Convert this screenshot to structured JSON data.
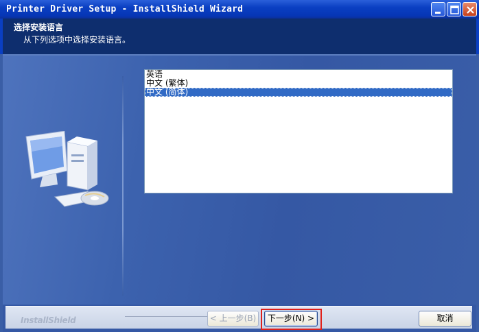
{
  "window": {
    "title": "Printer Driver Setup - InstallShield Wizard",
    "controls": [
      "minimize-icon",
      "maximize-icon",
      "close-icon"
    ]
  },
  "header": {
    "title": "选择安装语言",
    "subtitle": "从下列选项中选择安装语言。"
  },
  "languages": {
    "items": [
      "英语",
      "中文 (繁体)",
      "中文 (简体)"
    ],
    "selected": "中文 (简体)"
  },
  "footer": {
    "brand": "InstallShield",
    "back_label": "< 上一步(B)",
    "next_label": "下一步(N) >",
    "cancel_label": "取消"
  },
  "colors": {
    "titlebar": "#0a3fc2",
    "header": "#0e2e6e",
    "body": "#3a5ea6",
    "selection": "#316ac5",
    "highlight": "#e0211b"
  }
}
